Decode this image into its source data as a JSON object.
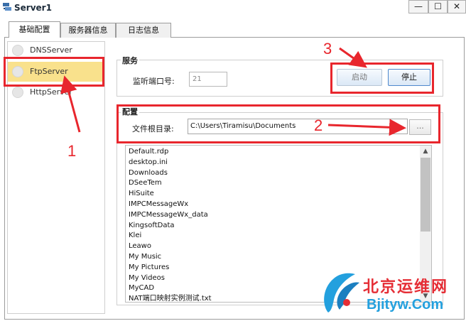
{
  "window": {
    "title": "Server1",
    "minimize_glyph": "—",
    "maximize_glyph": "☐",
    "close_glyph": "✕"
  },
  "tabs": [
    {
      "label": "基础配置",
      "selected": true
    },
    {
      "label": "服务器信息",
      "selected": false
    },
    {
      "label": "日志信息",
      "selected": false
    }
  ],
  "server_list": {
    "items": [
      {
        "label": "DNSServer",
        "selected": false
      },
      {
        "label": "FtpServer",
        "selected": true
      },
      {
        "label": "HttpServer",
        "selected": false
      }
    ]
  },
  "service": {
    "group_title": "服务",
    "port_label": "监听端口号:",
    "port_value": "21",
    "start_label": "启动",
    "stop_label": "停止"
  },
  "config": {
    "group_title": "配置",
    "root_label": "文件根目录:",
    "root_value": "C:\\Users\\Tiramisu\\Documents",
    "browse_label": "...",
    "files": [
      "Default.rdp",
      "desktop.ini",
      "Downloads",
      "DSeeTem",
      "HiSuite",
      "IMPCMessageWx",
      "IMPCMessageWx_data",
      "KingsoftData",
      "Klei",
      "Leawo",
      "My Music",
      "My Pictures",
      "My Videos",
      "MyCAD",
      "NAT端口映射实例测试.txt"
    ]
  },
  "annotations": {
    "color": "#e8262d",
    "labels": [
      "1",
      "2",
      "3"
    ]
  },
  "watermark": {
    "chinese": "北京运维网",
    "site": "Bjityw.Com"
  },
  "colors": {
    "selected_item": "#f9e18c",
    "button_border": "#4e88cd",
    "watermark_blue": "#23a0de"
  }
}
